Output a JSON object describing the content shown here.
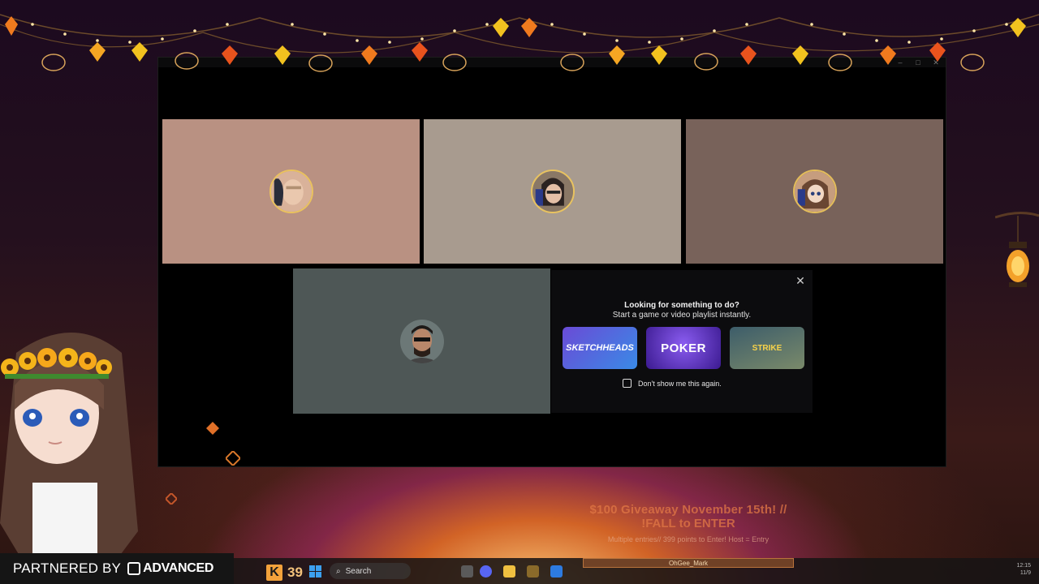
{
  "window": {
    "controls": [
      "minimize-icon",
      "maximize-icon",
      "close-icon"
    ]
  },
  "participants": [
    {
      "id": "p1",
      "tile_color": "#b99182"
    },
    {
      "id": "p2",
      "tile_color": "#a89b8f"
    },
    {
      "id": "p3",
      "tile_color": "#78625a"
    },
    {
      "id": "p4",
      "tile_color": "#4e5756"
    }
  ],
  "activity_panel": {
    "title": "Looking for something to do?",
    "subtitle": "Start a game or video playlist instantly.",
    "close_icon": "close-icon",
    "games": [
      {
        "label": "SKETCHHEADS"
      },
      {
        "label": "POKER"
      },
      {
        "label": "STRIKE"
      }
    ],
    "dont_show_label": "Don't show me this again."
  },
  "giveaway": {
    "line1": "$100 Giveaway November 15th! //",
    "line2": "!FALL to ENTER",
    "entries": "Multiple entries// 399 points to Enter! Host = Entry"
  },
  "partner": {
    "label": "PARTNERED BY",
    "brand": "ADVANCED"
  },
  "taskbar": {
    "k_letter": "K",
    "k_count": "39",
    "search_label": "Search",
    "viewer_name": "OhGee_Mark",
    "tray_time": "12:15",
    "tray_date": "11/9"
  },
  "colors": {
    "accent_orange": "#f3a23b",
    "discord_bg": "#000000",
    "panel_bg": "#0c0c0e"
  }
}
